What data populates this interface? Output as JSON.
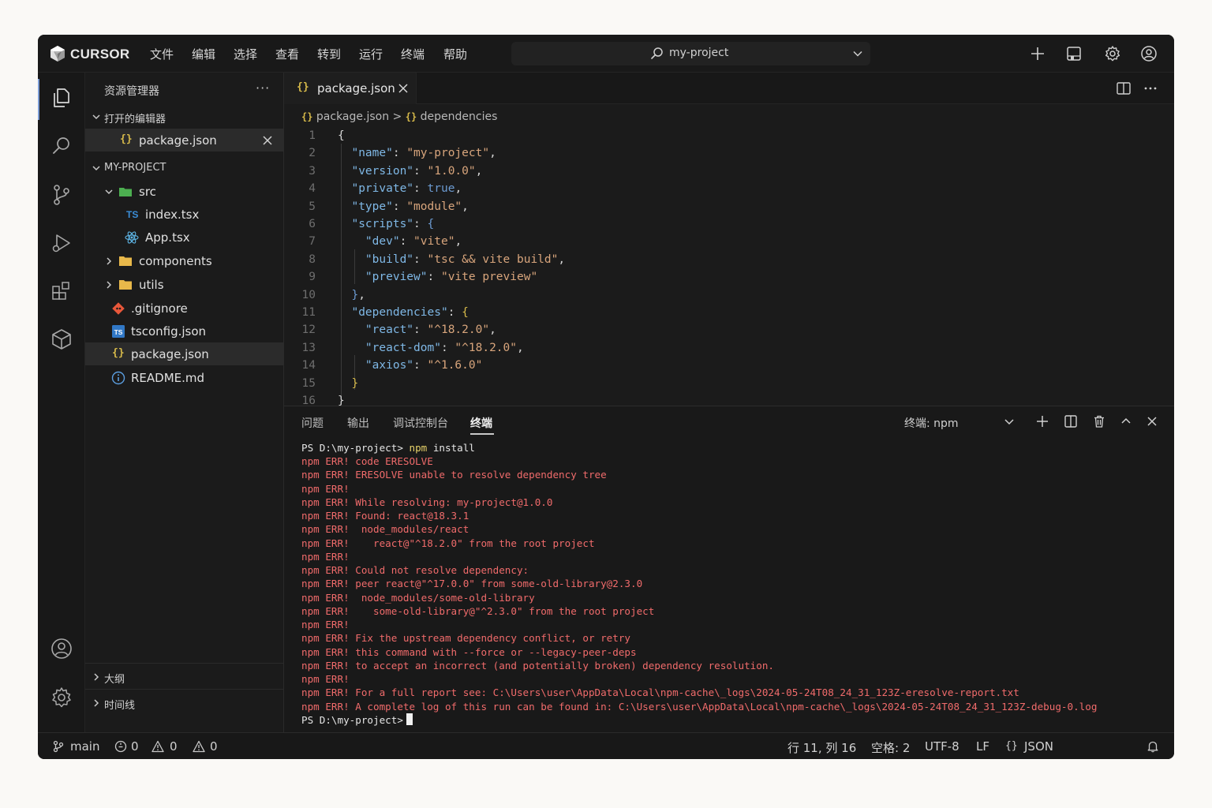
{
  "brand": "CURSOR",
  "menu": [
    "文件",
    "编辑",
    "选择",
    "查看",
    "转到",
    "运行",
    "终端",
    "帮助"
  ],
  "command_center": {
    "text": "my-project"
  },
  "sidebar": {
    "title": "资源管理器",
    "more": "···",
    "open_editors": {
      "header": "打开的编辑器",
      "items": [
        {
          "label": "package.json"
        }
      ]
    },
    "project": {
      "header": "MY-PROJECT",
      "items": [
        {
          "label": "src",
          "type": "folder-open"
        },
        {
          "label": "index.tsx",
          "type": "ts"
        },
        {
          "label": "App.tsx",
          "type": "react"
        },
        {
          "label": "components",
          "type": "folder"
        },
        {
          "label": "utils",
          "type": "folder"
        },
        {
          "label": ".gitignore",
          "type": "git"
        },
        {
          "label": "tsconfig.json",
          "type": "tsconfig"
        },
        {
          "label": "package.json",
          "type": "json"
        },
        {
          "label": "README.md",
          "type": "info"
        }
      ]
    },
    "outline": "大纲",
    "timeline": "时间线"
  },
  "editor": {
    "tab": {
      "label": "package.json",
      "icon": "{}"
    },
    "breadcrumb": {
      "file": "package.json",
      "sep": ">",
      "symbol": "dependencies",
      "icon": "{}"
    },
    "line_numbers": [
      "1",
      "2",
      "3",
      "4",
      "5",
      "6",
      "7",
      "8",
      "9",
      "10",
      "11",
      "12",
      "13",
      "14",
      "15",
      "16"
    ],
    "lines": [
      [
        [
          "p",
          "{"
        ]
      ],
      [
        [
          "p",
          "  "
        ],
        [
          "k",
          "\"name\""
        ],
        [
          "p",
          ": "
        ],
        [
          "s",
          "\"my-project\""
        ],
        [
          "p",
          ","
        ]
      ],
      [
        [
          "p",
          "  "
        ],
        [
          "k",
          "\"version\""
        ],
        [
          "p",
          ": "
        ],
        [
          "s",
          "\"1.0.0\""
        ],
        [
          "p",
          ","
        ]
      ],
      [
        [
          "p",
          "  "
        ],
        [
          "k",
          "\"private\""
        ],
        [
          "p",
          ": "
        ],
        [
          "b",
          "true"
        ],
        [
          "p",
          ","
        ]
      ],
      [
        [
          "p",
          "  "
        ],
        [
          "k",
          "\"type\""
        ],
        [
          "p",
          ": "
        ],
        [
          "s",
          "\"module\""
        ],
        [
          "p",
          ","
        ]
      ],
      [
        [
          "p",
          "  "
        ],
        [
          "k",
          "\"scripts\""
        ],
        [
          "p",
          ": "
        ],
        [
          "b",
          "{"
        ]
      ],
      [
        [
          "p",
          "    "
        ],
        [
          "k",
          "\"dev\""
        ],
        [
          "p",
          ": "
        ],
        [
          "s",
          "\"vite\""
        ],
        [
          "p",
          ","
        ]
      ],
      [
        [
          "p",
          "    "
        ],
        [
          "k",
          "\"build\""
        ],
        [
          "p",
          ": "
        ],
        [
          "s",
          "\"tsc && vite build\""
        ],
        [
          "p",
          ","
        ]
      ],
      [
        [
          "p",
          "    "
        ],
        [
          "k",
          "\"preview\""
        ],
        [
          "p",
          ": "
        ],
        [
          "s",
          "\"vite preview\""
        ]
      ],
      [
        [
          "p",
          "  "
        ],
        [
          "b",
          "}"
        ],
        [
          "p",
          ","
        ]
      ],
      [
        [
          "p",
          "  "
        ],
        [
          "k",
          "\"dependencies\""
        ],
        [
          "p",
          ": "
        ],
        [
          "br",
          "{"
        ]
      ],
      [
        [
          "p",
          "    "
        ],
        [
          "k",
          "\"react\""
        ],
        [
          "p",
          ": "
        ],
        [
          "s",
          "\"^18.2.0\""
        ],
        [
          "p",
          ","
        ]
      ],
      [
        [
          "p",
          "    "
        ],
        [
          "k",
          "\"react-dom\""
        ],
        [
          "p",
          ": "
        ],
        [
          "s",
          "\"^18.2.0\""
        ],
        [
          "p",
          ","
        ]
      ],
      [
        [
          "p",
          "    "
        ],
        [
          "k",
          "\"axios\""
        ],
        [
          "p",
          ": "
        ],
        [
          "s",
          "\"^1.6.0\""
        ]
      ],
      [
        [
          "p",
          "  "
        ],
        [
          "br",
          "}"
        ]
      ],
      [
        [
          "p",
          "}"
        ]
      ]
    ]
  },
  "panel": {
    "tabs": [
      "问题",
      "输出",
      "调试控制台",
      "终端"
    ],
    "active_tab": "终端",
    "terminal_select": "终端: npm",
    "prompt_line": {
      "prompt": "PS D:\\my-project> ",
      "cmd": "npm",
      "args": " install"
    },
    "output": [
      "npm ERR! code ERESOLVE",
      "npm ERR! ERESOLVE unable to resolve dependency tree",
      "npm ERR!",
      "npm ERR! While resolving: my-project@1.0.0",
      "npm ERR! Found: react@18.3.1",
      "npm ERR!  node_modules/react",
      "npm ERR!    react@\"^18.2.0\" from the root project",
      "npm ERR!",
      "npm ERR! Could not resolve dependency:",
      "npm ERR! peer react@\"^17.0.0\" from some-old-library@2.3.0",
      "npm ERR!  node_modules/some-old-library",
      "npm ERR!    some-old-library@\"^2.3.0\" from the root project",
      "npm ERR!",
      "npm ERR! Fix the upstream dependency conflict, or retry",
      "npm ERR! this command with --force or --legacy-peer-deps",
      "npm ERR! to accept an incorrect (and potentially broken) dependency resolution.",
      "npm ERR!",
      "npm ERR! For a full report see: C:\\Users\\user\\AppData\\Local\\npm-cache\\_logs\\2024-05-24T08_24_31_123Z-eresolve-report.txt",
      "npm ERR! A complete log of this run can be found in: C:\\Users\\user\\AppData\\Local\\npm-cache\\_logs\\2024-05-24T08_24_31_123Z-debug-0.log"
    ],
    "final_prompt": "PS D:\\my-project>"
  },
  "status": {
    "branch": "main",
    "ports": "0",
    "errors": "0",
    "warnings": "0",
    "position": "行 11, 列 16",
    "spaces": "空格: 2",
    "encoding": "UTF-8",
    "eol": "LF",
    "language": "JSON",
    "language_icon": "{}"
  },
  "colors": {
    "error_text": "#f06b6b",
    "accent": "#7c9dd6",
    "json_icon": "#d7ba4a",
    "ts_icon": "#3b8ed8"
  }
}
